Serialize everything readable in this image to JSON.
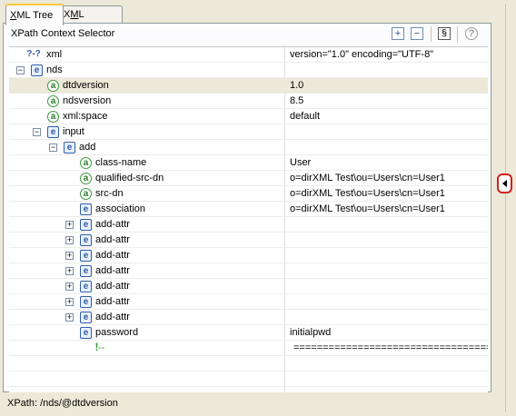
{
  "tabs": [
    {
      "label_underlined": "X",
      "label_rest": "ML Tree",
      "active": true
    },
    {
      "label_pre": "X",
      "label_underlined": "M",
      "label_rest": "L Source",
      "active": false
    }
  ],
  "selector": {
    "title": "XPath Context Selector"
  },
  "toolbar": {
    "expand_icon": "expand-all-icon",
    "collapse_icon": "collapse-all-icon",
    "script_icon": "script-icon",
    "help_icon": "help-icon"
  },
  "tree": {
    "rows": [
      {
        "toggle": "",
        "icon": "pi",
        "name": "xml",
        "value": "version=\"1.0\" encoding=\"UTF-8\"",
        "depth": 0
      },
      {
        "toggle": "−",
        "icon": "e",
        "name": "nds",
        "value": "",
        "depth": 0
      },
      {
        "toggle": "",
        "icon": "a",
        "name": "dtdversion",
        "value": "1.0",
        "depth": 1,
        "selected": true
      },
      {
        "toggle": "",
        "icon": "a",
        "name": "ndsversion",
        "value": "8.5",
        "depth": 1
      },
      {
        "toggle": "",
        "icon": "a",
        "name": "xml:space",
        "value": "default",
        "depth": 1
      },
      {
        "toggle": "−",
        "icon": "e",
        "name": "input",
        "value": "",
        "depth": 1
      },
      {
        "toggle": "−",
        "icon": "e",
        "name": "add",
        "value": "",
        "depth": 2
      },
      {
        "toggle": "",
        "icon": "a",
        "name": "class-name",
        "value": "User",
        "depth": 3
      },
      {
        "toggle": "",
        "icon": "a",
        "name": "qualified-src-dn",
        "value": "o=dirXML Test\\ou=Users\\cn=User1",
        "depth": 3
      },
      {
        "toggle": "",
        "icon": "a",
        "name": "src-dn",
        "value": "o=dirXML Test\\ou=Users\\cn=User1",
        "depth": 3
      },
      {
        "toggle": "",
        "icon": "e",
        "name": "association",
        "value": "o=dirXML Test\\ou=Users\\cn=User1",
        "depth": 3
      },
      {
        "toggle": "+",
        "icon": "e",
        "name": "add-attr",
        "value": "",
        "depth": 3
      },
      {
        "toggle": "+",
        "icon": "e",
        "name": "add-attr",
        "value": "",
        "depth": 3
      },
      {
        "toggle": "+",
        "icon": "e",
        "name": "add-attr",
        "value": "",
        "depth": 3
      },
      {
        "toggle": "+",
        "icon": "e",
        "name": "add-attr",
        "value": "",
        "depth": 3
      },
      {
        "toggle": "+",
        "icon": "e",
        "name": "add-attr",
        "value": "",
        "depth": 3
      },
      {
        "toggle": "+",
        "icon": "e",
        "name": "add-attr",
        "value": "",
        "depth": 3
      },
      {
        "toggle": "+",
        "icon": "e",
        "name": "add-attr",
        "value": "",
        "depth": 3
      },
      {
        "toggle": "",
        "icon": "e",
        "name": "password",
        "value": "initialpwd",
        "depth": 3
      },
      {
        "toggle": "",
        "icon": "cm",
        "name": "--",
        "value": "===========================================",
        "depth": 2
      },
      {
        "toggle": "",
        "icon": "",
        "name": "",
        "value": "",
        "depth": 0
      },
      {
        "toggle": "",
        "icon": "",
        "name": "",
        "value": "",
        "depth": 0
      }
    ]
  },
  "status": {
    "xpath": "XPath:  /nds/@dtdversion"
  },
  "side_button": {
    "icon": "collapse-left-arrow-icon"
  },
  "colors": {
    "accent_tab": "#ffc83c",
    "highlight_ring": "#d31f1f",
    "element_icon": "#2e5ea8",
    "attribute_icon": "#3b9a3b"
  }
}
